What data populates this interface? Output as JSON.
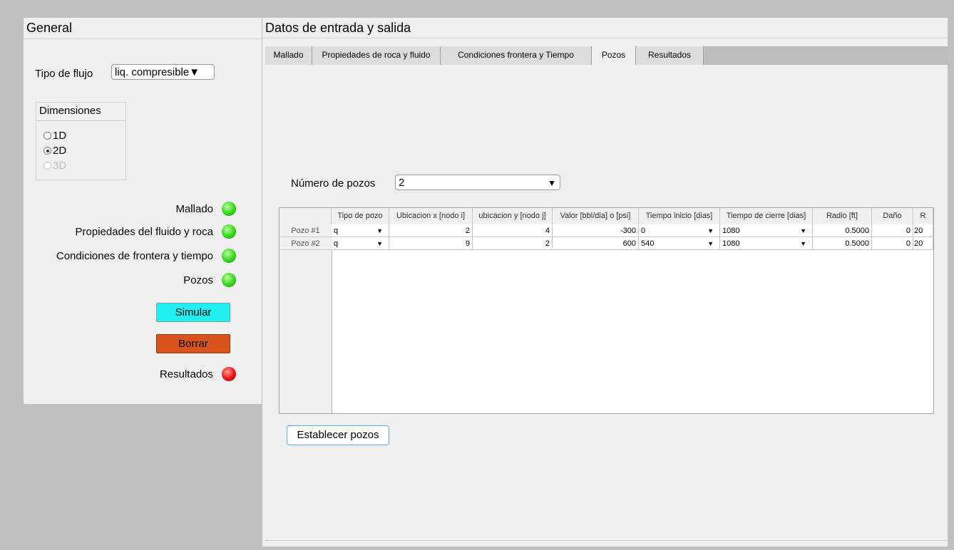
{
  "general": {
    "title": "General",
    "flow_type_label": "Tipo de flujo",
    "flow_type_value": "liq. compresible",
    "dimensions": {
      "title": "Dimensiones",
      "options": [
        {
          "label": "1D",
          "checked": false,
          "enabled": true
        },
        {
          "label": "2D",
          "checked": true,
          "enabled": true
        },
        {
          "label": "3D",
          "checked": false,
          "enabled": false
        }
      ]
    },
    "status": [
      {
        "label": "Mallado",
        "state": "green"
      },
      {
        "label": "Propiedades del fluido y roca",
        "state": "green"
      },
      {
        "label": "Condiciones de frontera y tiempo",
        "state": "green"
      },
      {
        "label": "Pozos",
        "state": "green"
      }
    ],
    "simular_label": "Simular",
    "borrar_label": "Borrar",
    "resultados_label": "Resultados",
    "resultados_state": "red"
  },
  "main": {
    "title": "Datos de entrada y salida",
    "tabs": [
      {
        "label": "Mallado",
        "active": false
      },
      {
        "label": "Propiedades de roca y fluido",
        "active": false
      },
      {
        "label": "Condiciones frontera y Tiempo",
        "active": false
      },
      {
        "label": "Pozos",
        "active": true
      },
      {
        "label": "Resultados",
        "active": false
      }
    ],
    "num_pozos_label": "Número de pozos",
    "num_pozos_value": "2",
    "table": {
      "columns": [
        "Tipo de pozo",
        "Ubicacion x [nodo i]",
        "ubicacion y [nodo j]",
        "Valor [bbl/dia] o [psi]",
        "Tiempo inicio [dias]",
        "Tiempo de cierre [dias]",
        "Radio [ft]",
        "Daño",
        "R"
      ],
      "rows": [
        {
          "name": "Pozo #1",
          "tipo": "q",
          "x": "2",
          "y": "4",
          "valor": "-300",
          "inicio": "0",
          "cierre": "1080",
          "radio": "0.5000",
          "dano": "0",
          "extra": "20"
        },
        {
          "name": "Pozo #2",
          "tipo": "q",
          "x": "9",
          "y": "2",
          "valor": "600",
          "inicio": "540",
          "cierre": "1080",
          "radio": "0.5000",
          "dano": "0",
          "extra": "20"
        }
      ]
    },
    "establecer_label": "Establecer pozos"
  },
  "colors": {
    "simular": "#22f0f0",
    "borrar": "#d9531e",
    "led_green": "#37d51d",
    "led_red": "#ee1111"
  }
}
